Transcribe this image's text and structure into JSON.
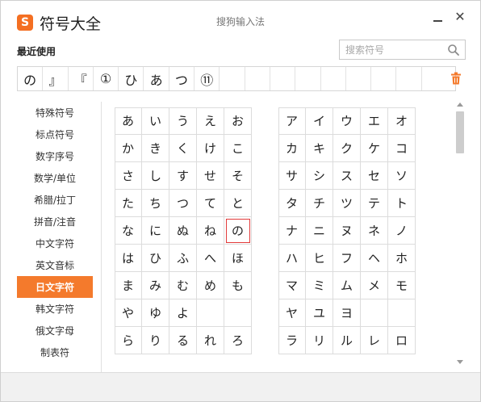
{
  "window": {
    "app_title": "符号大全",
    "caption": "搜狗输入法",
    "logo_letter": "S",
    "close_glyph": "✕",
    "accent": "#f47a2c"
  },
  "recent": {
    "label": "最近使用",
    "items": [
      "の",
      "』",
      "『",
      "①",
      "ひ",
      "あ",
      "つ",
      "⑪",
      "",
      "",
      "",
      "",
      "",
      "",
      "",
      "",
      ""
    ],
    "delete_icon": "trash-icon"
  },
  "search": {
    "placeholder": "搜索符号",
    "value": "",
    "icon": "search-icon"
  },
  "sidebar": {
    "items": [
      {
        "label": "特殊符号",
        "active": false
      },
      {
        "label": "标点符号",
        "active": false
      },
      {
        "label": "数字序号",
        "active": false
      },
      {
        "label": "数学/单位",
        "active": false
      },
      {
        "label": "希腊/拉丁",
        "active": false
      },
      {
        "label": "拼音/注音",
        "active": false
      },
      {
        "label": "中文字符",
        "active": false
      },
      {
        "label": "英文音标",
        "active": false
      },
      {
        "label": "日文字符",
        "active": true
      },
      {
        "label": "韩文字符",
        "active": false
      },
      {
        "label": "俄文字母",
        "active": false
      },
      {
        "label": "制表符",
        "active": false
      }
    ]
  },
  "hiragana": {
    "rows": [
      [
        "あ",
        "い",
        "う",
        "え",
        "お"
      ],
      [
        "か",
        "き",
        "く",
        "け",
        "こ"
      ],
      [
        "さ",
        "し",
        "す",
        "せ",
        "そ"
      ],
      [
        "た",
        "ち",
        "つ",
        "て",
        "と"
      ],
      [
        "な",
        "に",
        "ぬ",
        "ね",
        "の"
      ],
      [
        "は",
        "ひ",
        "ふ",
        "へ",
        "ほ"
      ],
      [
        "ま",
        "み",
        "む",
        "め",
        "も"
      ],
      [
        "や",
        "ゆ",
        "よ",
        "",
        ""
      ],
      [
        "ら",
        "り",
        "る",
        "れ",
        "ろ"
      ]
    ],
    "selected": "の"
  },
  "katakana": {
    "rows": [
      [
        "ア",
        "イ",
        "ウ",
        "エ",
        "オ"
      ],
      [
        "カ",
        "キ",
        "ク",
        "ケ",
        "コ"
      ],
      [
        "サ",
        "シ",
        "ス",
        "セ",
        "ソ"
      ],
      [
        "タ",
        "チ",
        "ツ",
        "テ",
        "ト"
      ],
      [
        "ナ",
        "ニ",
        "ヌ",
        "ネ",
        "ノ"
      ],
      [
        "ハ",
        "ヒ",
        "フ",
        "ヘ",
        "ホ"
      ],
      [
        "マ",
        "ミ",
        "ム",
        "メ",
        "モ"
      ],
      [
        "ヤ",
        "ユ",
        "ヨ",
        "",
        ""
      ],
      [
        "ラ",
        "リ",
        "ル",
        "レ",
        "ロ"
      ]
    ]
  }
}
